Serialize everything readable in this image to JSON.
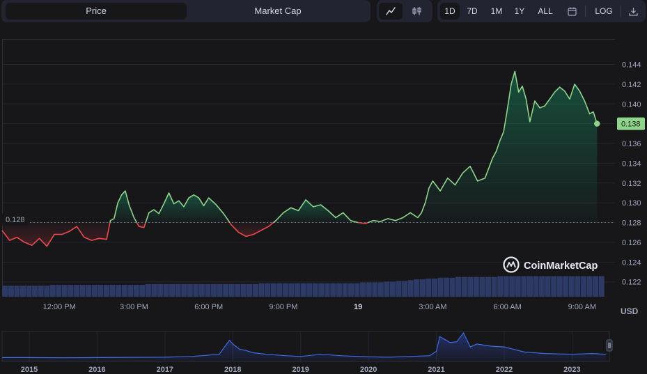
{
  "toolbar": {
    "tabs": [
      {
        "label": "Price",
        "active": true
      },
      {
        "label": "Market Cap",
        "active": false
      }
    ],
    "modes": [
      {
        "icon": "line-chart-icon",
        "active": true
      },
      {
        "icon": "candlestick-icon",
        "active": false
      }
    ],
    "ranges": [
      {
        "label": "1D",
        "active": true
      },
      {
        "label": "7D",
        "active": false
      },
      {
        "label": "1M",
        "active": false
      },
      {
        "label": "1Y",
        "active": false
      },
      {
        "label": "ALL",
        "active": false
      }
    ],
    "calendar_icon": "calendar-icon",
    "log_label": "LOG",
    "download_icon": "download-icon"
  },
  "chart_data": [
    {
      "type": "line",
      "open_price": "0.128",
      "open_value": 0.128,
      "current_label": "0.138",
      "currency": "USD",
      "watermark": "CoinMarketCap",
      "colors": {
        "up": "#16c784",
        "down": "#ea3943",
        "line_up": "#8fd48b",
        "line_down": "#ea4b4f",
        "volume": "#2e3a66"
      },
      "ylim": [
        0.1205,
        0.1465
      ],
      "yticks": [
        "0.144",
        "0.142",
        "0.140",
        "0.138",
        "0.136",
        "0.134",
        "0.132",
        "0.130",
        "0.128",
        "0.126",
        "0.124",
        "0.122"
      ],
      "ytick_values": [
        0.144,
        0.142,
        0.14,
        0.138,
        0.136,
        0.134,
        0.132,
        0.13,
        0.128,
        0.126,
        0.124,
        0.122
      ],
      "xticks": [
        "12:00 PM",
        "3:00 PM",
        "6:00 PM",
        "9:00 PM",
        "19",
        "3:00 AM",
        "6:00 AM",
        "9:00 AM"
      ],
      "xtick_hours": [
        2.3,
        5.3,
        8.3,
        11.3,
        14.3,
        17.3,
        20.3,
        23.3
      ],
      "x_range_hours": [
        0,
        24.2
      ],
      "x_hours": [
        0,
        0.3,
        0.6,
        0.9,
        1.2,
        1.5,
        1.8,
        2.1,
        2.4,
        2.7,
        3.0,
        3.3,
        3.6,
        3.9,
        4.2,
        4.35,
        4.5,
        4.65,
        4.8,
        4.95,
        5.1,
        5.3,
        5.5,
        5.7,
        5.9,
        6.1,
        6.3,
        6.5,
        6.7,
        6.9,
        7.1,
        7.3,
        7.5,
        7.7,
        7.9,
        8.1,
        8.3,
        8.6,
        8.9,
        9.2,
        9.5,
        9.8,
        10.1,
        10.4,
        10.7,
        11.0,
        11.3,
        11.6,
        11.9,
        12.2,
        12.5,
        12.8,
        13.1,
        13.4,
        13.7,
        14.0,
        14.3,
        14.6,
        14.9,
        15.2,
        15.5,
        15.8,
        16.1,
        16.4,
        16.7,
        16.85,
        17.0,
        17.15,
        17.3,
        17.6,
        17.9,
        18.2,
        18.5,
        18.8,
        19.1,
        19.4,
        19.7,
        19.85,
        20.0,
        20.15,
        20.3,
        20.45,
        20.6,
        20.75,
        20.9,
        21.05,
        21.2,
        21.4,
        21.6,
        21.8,
        22.0,
        22.2,
        22.4,
        22.6,
        22.8,
        23.0,
        23.2,
        23.4,
        23.6,
        23.75,
        23.9
      ],
      "values": [
        0.1272,
        0.1262,
        0.1265,
        0.126,
        0.1257,
        0.1264,
        0.1256,
        0.1268,
        0.1268,
        0.1271,
        0.1276,
        0.1265,
        0.1262,
        0.1264,
        0.1263,
        0.1282,
        0.1284,
        0.13,
        0.1308,
        0.1312,
        0.1298,
        0.1285,
        0.1276,
        0.1275,
        0.129,
        0.1293,
        0.1289,
        0.1299,
        0.131,
        0.1299,
        0.1302,
        0.1296,
        0.1305,
        0.1308,
        0.1305,
        0.1297,
        0.1305,
        0.1298,
        0.1289,
        0.1278,
        0.127,
        0.1266,
        0.1268,
        0.1272,
        0.1276,
        0.1282,
        0.129,
        0.1295,
        0.1292,
        0.1303,
        0.1296,
        0.1298,
        0.1292,
        0.1285,
        0.129,
        0.1282,
        0.128,
        0.1279,
        0.1282,
        0.1281,
        0.1284,
        0.1282,
        0.1285,
        0.129,
        0.1285,
        0.129,
        0.13,
        0.1315,
        0.1322,
        0.1312,
        0.1325,
        0.1318,
        0.133,
        0.1337,
        0.1322,
        0.1325,
        0.1345,
        0.1352,
        0.1363,
        0.1372,
        0.1395,
        0.142,
        0.1433,
        0.1412,
        0.1418,
        0.1405,
        0.1382,
        0.1403,
        0.1396,
        0.1398,
        0.1405,
        0.1412,
        0.1417,
        0.1413,
        0.1405,
        0.142,
        0.1413,
        0.1403,
        0.139,
        0.1392,
        0.138
      ],
      "volume_values": [
        14,
        14,
        14,
        14,
        14,
        14,
        14,
        14,
        15,
        15,
        15,
        15,
        15,
        15,
        15,
        15,
        15,
        15,
        15,
        15,
        15,
        15,
        15,
        15,
        16,
        16,
        16,
        16,
        16,
        16,
        16,
        16,
        16,
        16,
        16,
        16,
        16,
        16,
        16,
        16,
        16,
        16,
        16,
        17,
        17,
        17,
        17,
        17,
        17,
        17,
        17,
        17,
        17,
        17,
        17,
        17,
        17,
        17,
        17,
        17,
        18,
        18,
        18,
        18,
        19,
        19,
        20,
        20,
        21,
        22,
        22,
        23,
        23,
        24,
        24,
        24,
        25,
        25,
        25,
        25,
        25,
        25,
        25,
        26,
        26,
        26,
        26,
        26,
        26,
        26,
        26,
        26,
        26,
        26,
        26,
        26,
        26,
        26,
        26,
        26,
        26
      ]
    },
    {
      "type": "area",
      "xticks": [
        "2015",
        "2016",
        "2017",
        "2018",
        "2019",
        "2020",
        "2021",
        "2022",
        "2023"
      ],
      "xtick_years": [
        2015,
        2016,
        2017,
        2018,
        2019,
        2020,
        2021,
        2022,
        2023
      ],
      "x_range_years": [
        2014.6,
        2023.55
      ],
      "x_years": [
        2014.6,
        2015.0,
        2015.5,
        2016.0,
        2016.5,
        2017.0,
        2017.4,
        2017.8,
        2017.95,
        2018.0,
        2018.1,
        2018.2,
        2018.3,
        2018.5,
        2018.8,
        2019.0,
        2019.3,
        2019.6,
        2020.0,
        2020.3,
        2020.6,
        2020.9,
        2021.0,
        2021.05,
        2021.2,
        2021.3,
        2021.4,
        2021.5,
        2021.6,
        2021.8,
        2022.0,
        2022.3,
        2022.6,
        2023.0,
        2023.3,
        2023.5
      ],
      "values": [
        0.0015,
        0.0015,
        0.0012,
        0.0015,
        0.0018,
        0.002,
        0.003,
        0.006,
        0.025,
        0.02,
        0.013,
        0.011,
        0.008,
        0.006,
        0.004,
        0.003,
        0.006,
        0.004,
        0.0025,
        0.002,
        0.003,
        0.004,
        0.01,
        0.03,
        0.022,
        0.023,
        0.035,
        0.016,
        0.02,
        0.017,
        0.016,
        0.009,
        0.007,
        0.006,
        0.007,
        0.006
      ],
      "ylim": [
        0,
        0.035
      ]
    }
  ]
}
